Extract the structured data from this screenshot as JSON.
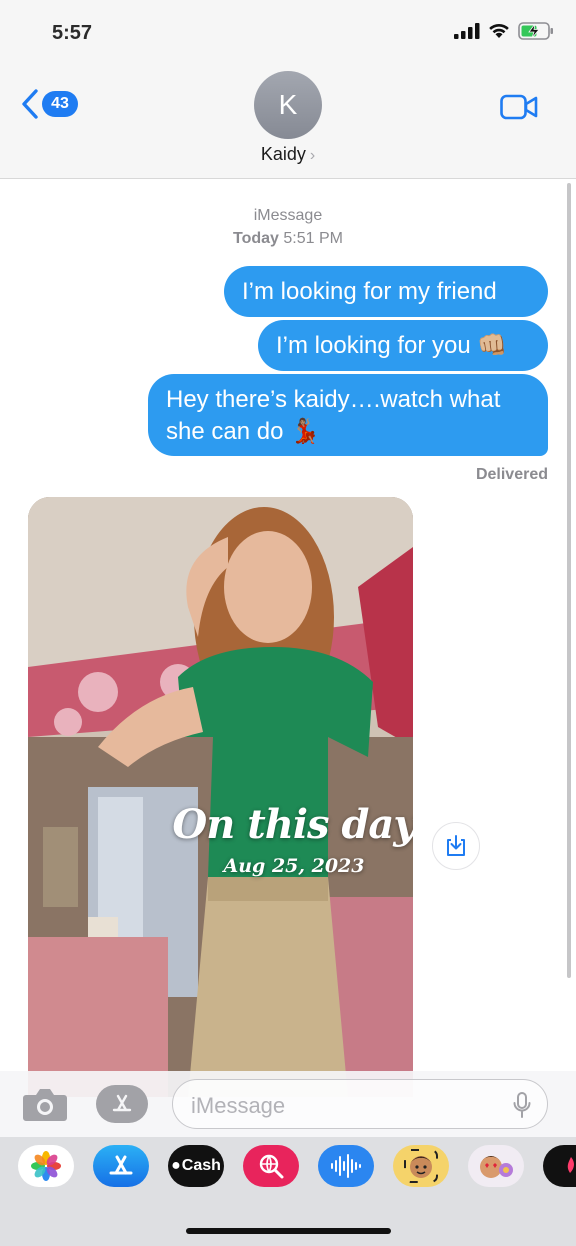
{
  "status_bar": {
    "time": "5:57"
  },
  "header": {
    "back_count": "43",
    "avatar_initial": "K",
    "contact_name": "Kaidy",
    "contact_chevron": "›"
  },
  "conversation": {
    "service": "iMessage",
    "day": "Today",
    "time": "5:51 PM",
    "messages": [
      {
        "from": "me",
        "text": "I’m looking for my friend"
      },
      {
        "from": "me",
        "text": "I’m looking for you 👊🏼"
      },
      {
        "from": "me",
        "text": "Hey there’s kaidy….watch what she can do 💃🏽"
      }
    ],
    "delivery_status": "Delivered"
  },
  "memory_card": {
    "title": "On this day",
    "date": "Aug 25, 2023"
  },
  "composer": {
    "placeholder": "iMessage"
  },
  "app_drawer": {
    "apps": [
      {
        "name": "photos-app",
        "label": ""
      },
      {
        "name": "app-store-app",
        "label": ""
      },
      {
        "name": "apple-cash-app",
        "label": "Cash"
      },
      {
        "name": "search-images-app",
        "label": ""
      },
      {
        "name": "audio-message-app",
        "label": ""
      },
      {
        "name": "memoji-app",
        "label": ""
      },
      {
        "name": "memoji-stickers-app",
        "label": ""
      },
      {
        "name": "digital-touch-app",
        "label": ""
      }
    ]
  },
  "colors": {
    "bubble_blue": "#2d9bf0",
    "ios_blue": "#1f7cf2",
    "meta_gray": "#8b8b90"
  }
}
